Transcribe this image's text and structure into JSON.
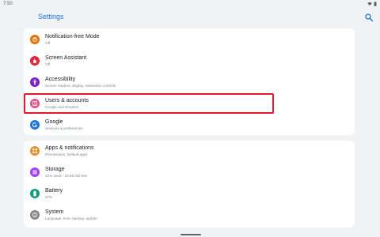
{
  "status_bar": {
    "time": "7:50"
  },
  "app_bar": {
    "title": "Settings",
    "search_icon": "search-icon"
  },
  "groups": [
    {
      "items": [
        {
          "title": "Notification-free Mode",
          "subtitle": "Off",
          "icon": "moon-icon",
          "color": "#e8710a"
        },
        {
          "title": "Screen Assistant",
          "subtitle": "Off",
          "icon": "hand-icon",
          "color": "#e8233a"
        },
        {
          "title": "Accessibility",
          "subtitle": "Screen readers, display, interaction controls",
          "icon": "accessibility-icon",
          "color": "#7b1fd1"
        },
        {
          "title": "Users & accounts",
          "subtitle": "Google and Dropbox",
          "icon": "account-icon",
          "color": "#ea4c89"
        },
        {
          "title": "Google",
          "subtitle": "Services & preferences",
          "icon": "google-icon",
          "color": "#1a73e8"
        }
      ]
    },
    {
      "items": [
        {
          "title": "Apps & notifications",
          "subtitle": "Permissions, Default apps",
          "icon": "apps-icon",
          "color": "#f28b1c"
        },
        {
          "title": "Storage",
          "subtitle": "42% used - 18.55 GB free",
          "icon": "storage-icon",
          "color": "#a142f4"
        },
        {
          "title": "Battery",
          "subtitle": "37%",
          "icon": "battery-icon",
          "color": "#129c7d"
        },
        {
          "title": "System",
          "subtitle": "Language, time, backup, update",
          "icon": "info-icon",
          "color": "#80868b"
        }
      ]
    }
  ]
}
